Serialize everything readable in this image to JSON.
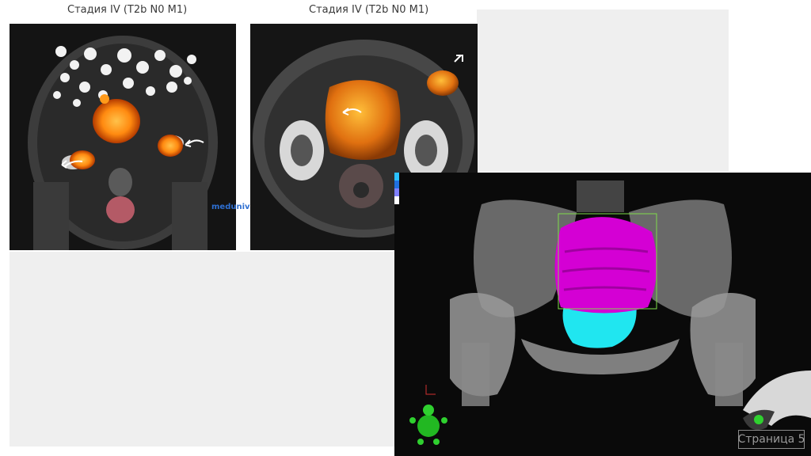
{
  "captions": {
    "left": "Стадия IV (T2b N0 M1)",
    "right": "Стадия IV (T2b N0 M1)"
  },
  "watermark": {
    "text": "meduniver.com"
  },
  "plan": {
    "readout_lines": [
      "",
      "",
      "",
      ""
    ]
  },
  "footer": {
    "page_label": "Страница 5"
  },
  "colors": {
    "pet_orange": "#ff9a1a",
    "bladder_magenta": "#d400d4",
    "prostate_cyan": "#20e6f0",
    "contour_green": "#7fdc4a"
  },
  "icons": [
    "arrow-icon",
    "orientation-figure-icon",
    "medical-cross-icon"
  ]
}
